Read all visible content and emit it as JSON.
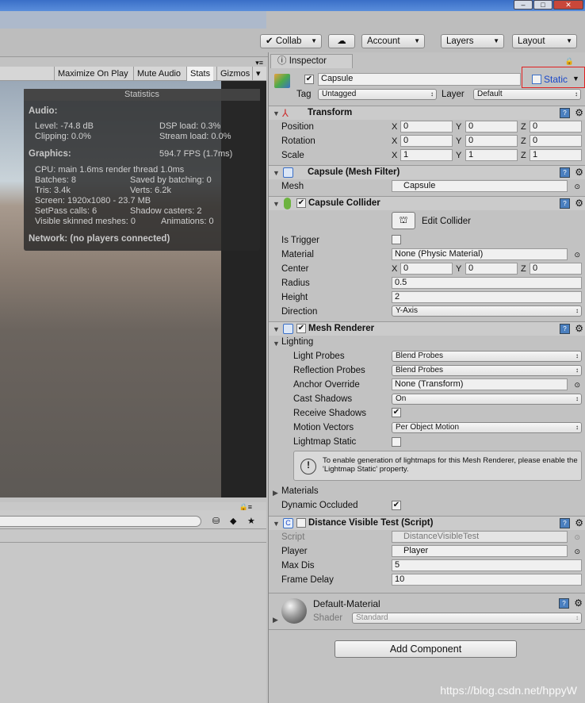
{
  "toolbar": {
    "collab": "Collab",
    "account": "Account",
    "layers": "Layers",
    "layout": "Layout"
  },
  "game_toolbar": {
    "maximize": "Maximize On Play",
    "mute": "Mute Audio",
    "stats": "Stats",
    "gizmos": "Gizmos"
  },
  "stats": {
    "title": "Statistics",
    "audio_header": "Audio:",
    "level": "Level: -74.8 dB",
    "dsp": "DSP load: 0.3%",
    "clipping": "Clipping: 0.0%",
    "stream": "Stream load: 0.0%",
    "graphics_header": "Graphics:",
    "fps": "594.7 FPS (1.7ms)",
    "cpu": "CPU: main 1.6ms  render thread 1.0ms",
    "batches": "Batches: 8",
    "saved": "Saved by batching: 0",
    "tris": "Tris: 3.4k",
    "verts": "Verts: 6.2k",
    "screen": "Screen: 1920x1080 - 23.7 MB",
    "setpass": "SetPass calls: 6",
    "shadow": "Shadow casters: 2",
    "skinned": "Visible skinned meshes: 0",
    "animations": "Animations: 0",
    "network": "Network: (no players connected)"
  },
  "inspector": {
    "tab": "Inspector",
    "name": "Capsule",
    "static": "Static",
    "tag_label": "Tag",
    "tag": "Untagged",
    "layer_label": "Layer",
    "layer": "Default",
    "transform": {
      "title": "Transform",
      "position": "Position",
      "rotation": "Rotation",
      "scale": "Scale",
      "x": "X",
      "y": "Y",
      "z": "Z",
      "pos": [
        "0",
        "0",
        "0"
      ],
      "rot": [
        "0",
        "0",
        "0"
      ],
      "scl": [
        "1",
        "1",
        "1"
      ]
    },
    "mesh_filter": {
      "title": "Capsule (Mesh Filter)",
      "mesh_label": "Mesh",
      "mesh": "Capsule"
    },
    "collider": {
      "title": "Capsule Collider",
      "edit": "Edit Collider",
      "is_trigger": "Is Trigger",
      "material_label": "Material",
      "material": "None (Physic Material)",
      "center_label": "Center",
      "center": [
        "0",
        "0",
        "0"
      ],
      "radius_label": "Radius",
      "radius": "0.5",
      "height_label": "Height",
      "height": "2",
      "direction_label": "Direction",
      "direction": "Y-Axis"
    },
    "renderer": {
      "title": "Mesh Renderer",
      "lighting": "Lighting",
      "light_probes_label": "Light Probes",
      "light_probes": "Blend Probes",
      "reflection_label": "Reflection Probes",
      "reflection": "Blend Probes",
      "anchor_label": "Anchor Override",
      "anchor": "None (Transform)",
      "cast_label": "Cast Shadows",
      "cast": "On",
      "receive_label": "Receive Shadows",
      "motion_label": "Motion Vectors",
      "motion": "Per Object Motion",
      "lightmap_label": "Lightmap Static",
      "help": "To enable generation of lightmaps for this Mesh Renderer, please enable the 'Lightmap Static' property.",
      "materials": "Materials",
      "dynamic": "Dynamic Occluded"
    },
    "script": {
      "title": "Distance Visible Test (Script)",
      "script_label": "Script",
      "script": "DistanceVisibleTest",
      "player_label": "Player",
      "player": "Player",
      "maxdis_label": "Max Dis",
      "maxdis": "5",
      "delay_label": "Frame Delay",
      "delay": "10"
    },
    "material": {
      "name": "Default-Material",
      "shader_label": "Shader",
      "shader": "Standard"
    },
    "add_component": "Add Component"
  },
  "watermark": "https://blog.csdn.net/hppyW"
}
